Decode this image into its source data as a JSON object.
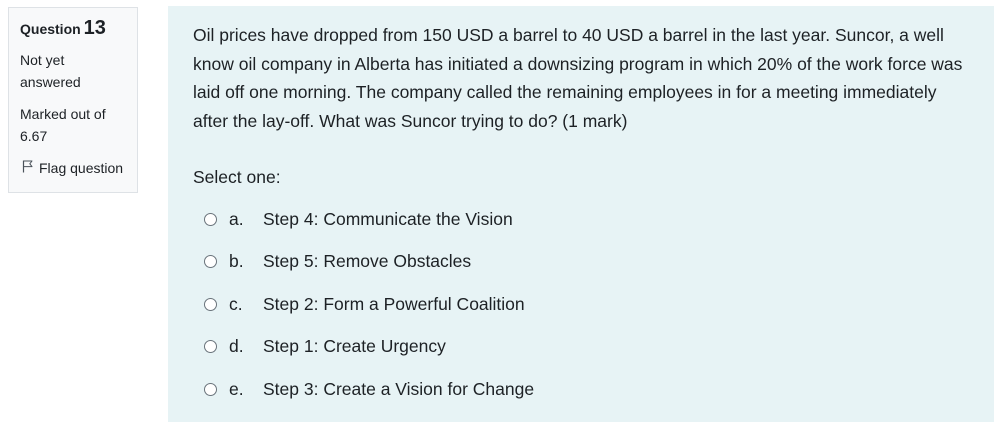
{
  "info": {
    "question_label": "Question",
    "question_number": "13",
    "state": "Not yet answered",
    "grade": "Marked out of 6.67",
    "flag_label": "Flag question",
    "flag_icon": "flag-outline-icon"
  },
  "question": {
    "text": "Oil prices have dropped from 150 USD a barrel to 40 USD a barrel in the last year. Suncor, a well know oil company in Alberta has initiated a downsizing program in which 20% of the work force was laid off one morning. The company called the remaining employees in for a meeting immediately after the lay-off. What was Suncor trying to do? (1 mark)",
    "prompt": "Select one:",
    "options": [
      {
        "letter": "a.",
        "label": "Step 4: Communicate the Vision"
      },
      {
        "letter": "b.",
        "label": "Step 5: Remove Obstacles"
      },
      {
        "letter": "c.",
        "label": "Step 2: Form a Powerful Coalition"
      },
      {
        "letter": "d.",
        "label": "Step 1: Create Urgency"
      },
      {
        "letter": "e.",
        "label": "Step 3: Create a Vision for Change"
      }
    ]
  },
  "colors": {
    "info_bg": "#f8f9fa",
    "content_bg": "#e7f3f5",
    "text": "#1d2125"
  }
}
